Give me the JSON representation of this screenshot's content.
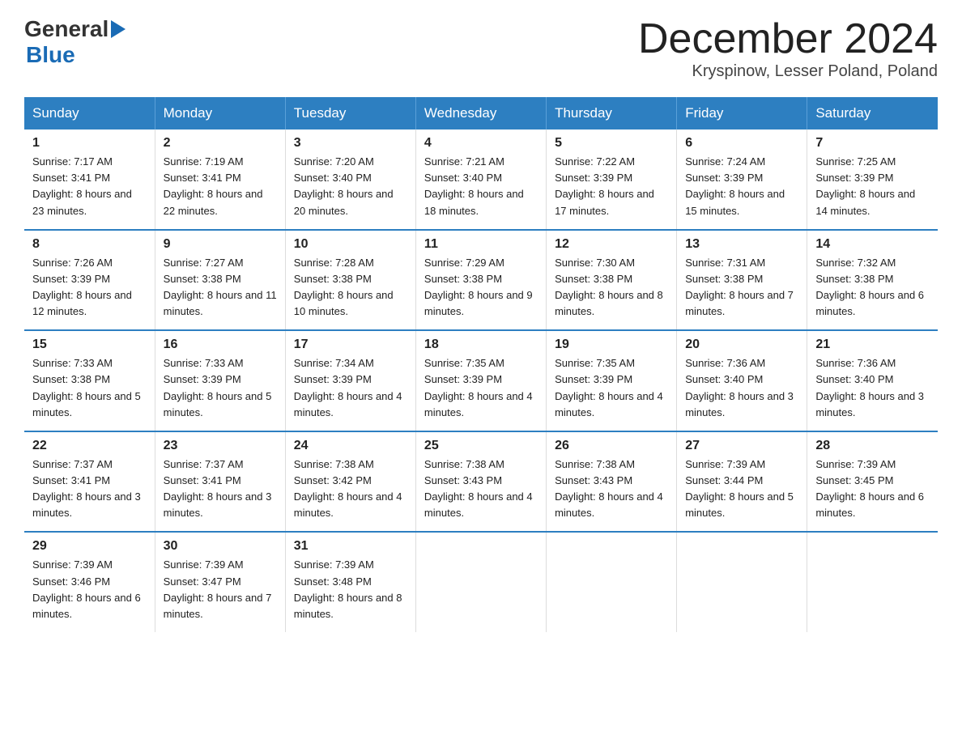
{
  "logo": {
    "general": "General",
    "blue": "Blue",
    "line2": "Blue"
  },
  "title": {
    "month_year": "December 2024",
    "location": "Kryspinow, Lesser Poland, Poland"
  },
  "header_days": [
    "Sunday",
    "Monday",
    "Tuesday",
    "Wednesday",
    "Thursday",
    "Friday",
    "Saturday"
  ],
  "weeks": [
    [
      {
        "day": "1",
        "info": "Sunrise: 7:17 AM\nSunset: 3:41 PM\nDaylight: 8 hours\nand 23 minutes."
      },
      {
        "day": "2",
        "info": "Sunrise: 7:19 AM\nSunset: 3:41 PM\nDaylight: 8 hours\nand 22 minutes."
      },
      {
        "day": "3",
        "info": "Sunrise: 7:20 AM\nSunset: 3:40 PM\nDaylight: 8 hours\nand 20 minutes."
      },
      {
        "day": "4",
        "info": "Sunrise: 7:21 AM\nSunset: 3:40 PM\nDaylight: 8 hours\nand 18 minutes."
      },
      {
        "day": "5",
        "info": "Sunrise: 7:22 AM\nSunset: 3:39 PM\nDaylight: 8 hours\nand 17 minutes."
      },
      {
        "day": "6",
        "info": "Sunrise: 7:24 AM\nSunset: 3:39 PM\nDaylight: 8 hours\nand 15 minutes."
      },
      {
        "day": "7",
        "info": "Sunrise: 7:25 AM\nSunset: 3:39 PM\nDaylight: 8 hours\nand 14 minutes."
      }
    ],
    [
      {
        "day": "8",
        "info": "Sunrise: 7:26 AM\nSunset: 3:39 PM\nDaylight: 8 hours\nand 12 minutes."
      },
      {
        "day": "9",
        "info": "Sunrise: 7:27 AM\nSunset: 3:38 PM\nDaylight: 8 hours\nand 11 minutes."
      },
      {
        "day": "10",
        "info": "Sunrise: 7:28 AM\nSunset: 3:38 PM\nDaylight: 8 hours\nand 10 minutes."
      },
      {
        "day": "11",
        "info": "Sunrise: 7:29 AM\nSunset: 3:38 PM\nDaylight: 8 hours\nand 9 minutes."
      },
      {
        "day": "12",
        "info": "Sunrise: 7:30 AM\nSunset: 3:38 PM\nDaylight: 8 hours\nand 8 minutes."
      },
      {
        "day": "13",
        "info": "Sunrise: 7:31 AM\nSunset: 3:38 PM\nDaylight: 8 hours\nand 7 minutes."
      },
      {
        "day": "14",
        "info": "Sunrise: 7:32 AM\nSunset: 3:38 PM\nDaylight: 8 hours\nand 6 minutes."
      }
    ],
    [
      {
        "day": "15",
        "info": "Sunrise: 7:33 AM\nSunset: 3:38 PM\nDaylight: 8 hours\nand 5 minutes."
      },
      {
        "day": "16",
        "info": "Sunrise: 7:33 AM\nSunset: 3:39 PM\nDaylight: 8 hours\nand 5 minutes."
      },
      {
        "day": "17",
        "info": "Sunrise: 7:34 AM\nSunset: 3:39 PM\nDaylight: 8 hours\nand 4 minutes."
      },
      {
        "day": "18",
        "info": "Sunrise: 7:35 AM\nSunset: 3:39 PM\nDaylight: 8 hours\nand 4 minutes."
      },
      {
        "day": "19",
        "info": "Sunrise: 7:35 AM\nSunset: 3:39 PM\nDaylight: 8 hours\nand 4 minutes."
      },
      {
        "day": "20",
        "info": "Sunrise: 7:36 AM\nSunset: 3:40 PM\nDaylight: 8 hours\nand 3 minutes."
      },
      {
        "day": "21",
        "info": "Sunrise: 7:36 AM\nSunset: 3:40 PM\nDaylight: 8 hours\nand 3 minutes."
      }
    ],
    [
      {
        "day": "22",
        "info": "Sunrise: 7:37 AM\nSunset: 3:41 PM\nDaylight: 8 hours\nand 3 minutes."
      },
      {
        "day": "23",
        "info": "Sunrise: 7:37 AM\nSunset: 3:41 PM\nDaylight: 8 hours\nand 3 minutes."
      },
      {
        "day": "24",
        "info": "Sunrise: 7:38 AM\nSunset: 3:42 PM\nDaylight: 8 hours\nand 4 minutes."
      },
      {
        "day": "25",
        "info": "Sunrise: 7:38 AM\nSunset: 3:43 PM\nDaylight: 8 hours\nand 4 minutes."
      },
      {
        "day": "26",
        "info": "Sunrise: 7:38 AM\nSunset: 3:43 PM\nDaylight: 8 hours\nand 4 minutes."
      },
      {
        "day": "27",
        "info": "Sunrise: 7:39 AM\nSunset: 3:44 PM\nDaylight: 8 hours\nand 5 minutes."
      },
      {
        "day": "28",
        "info": "Sunrise: 7:39 AM\nSunset: 3:45 PM\nDaylight: 8 hours\nand 6 minutes."
      }
    ],
    [
      {
        "day": "29",
        "info": "Sunrise: 7:39 AM\nSunset: 3:46 PM\nDaylight: 8 hours\nand 6 minutes."
      },
      {
        "day": "30",
        "info": "Sunrise: 7:39 AM\nSunset: 3:47 PM\nDaylight: 8 hours\nand 7 minutes."
      },
      {
        "day": "31",
        "info": "Sunrise: 7:39 AM\nSunset: 3:48 PM\nDaylight: 8 hours\nand 8 minutes."
      },
      {
        "day": "",
        "info": ""
      },
      {
        "day": "",
        "info": ""
      },
      {
        "day": "",
        "info": ""
      },
      {
        "day": "",
        "info": ""
      }
    ]
  ]
}
